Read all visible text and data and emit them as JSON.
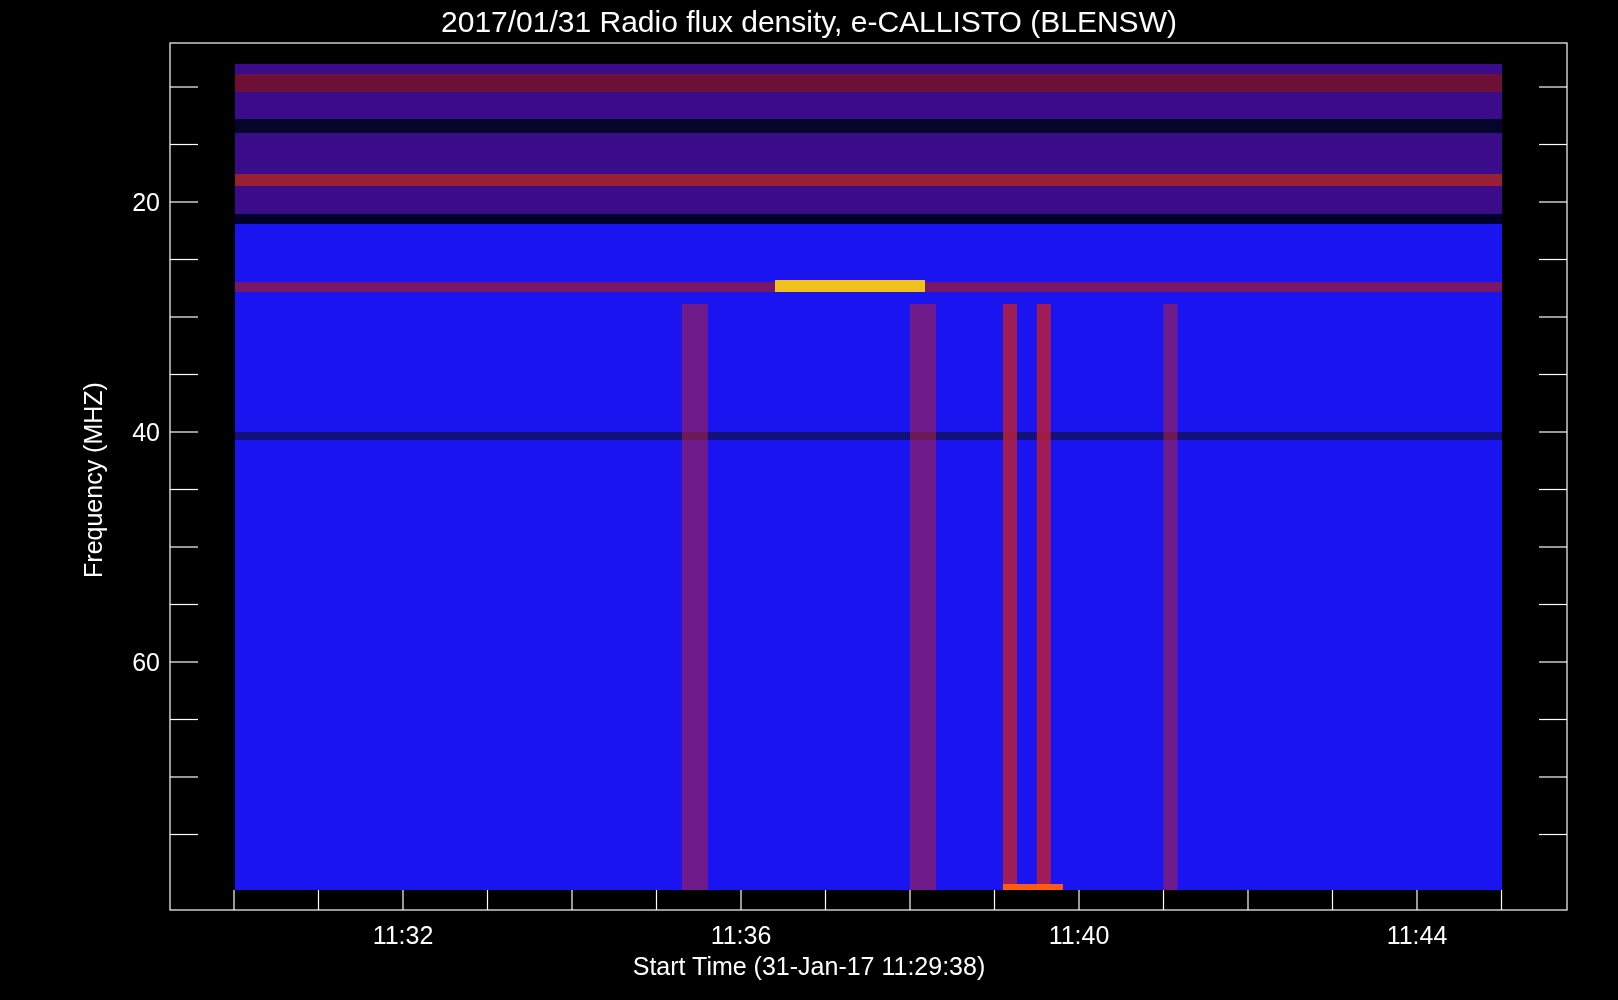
{
  "title": "2017/01/31  Radio flux density, e-CALLISTO (BLENSW)",
  "y_axis": {
    "label": "Frequency (MHZ)",
    "tick_labels": [
      "20",
      "40",
      "60"
    ]
  },
  "x_axis": {
    "label": "Start Time (31-Jan-17 11:29:38)",
    "tick_labels": [
      "11:32",
      "11:36",
      "11:40",
      "11:44"
    ]
  }
}
